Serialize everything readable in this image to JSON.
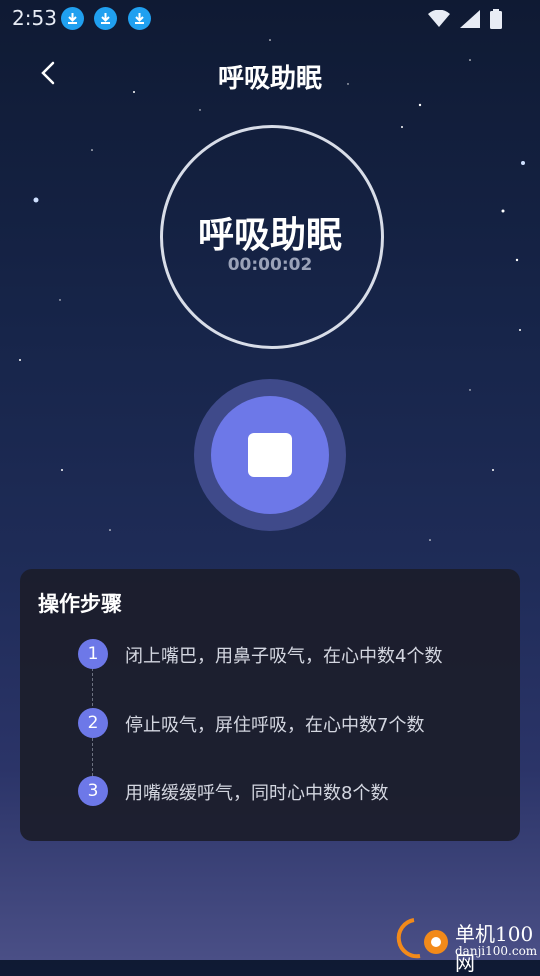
{
  "status": {
    "time": "2:53"
  },
  "header": {
    "title": "呼吸助眠"
  },
  "player": {
    "title": "呼吸助眠",
    "timer": "00:00:02"
  },
  "steps_panel": {
    "title": "操作步骤",
    "steps": [
      {
        "num": "1",
        "text": "闭上嘴巴，用鼻子吸气，在心中数4个数"
      },
      {
        "num": "2",
        "text": "停止吸气，屏住呼吸，在心中数7个数"
      },
      {
        "num": "3",
        "text": "用嘴缓缓呼气，同时心中数8个数"
      }
    ]
  },
  "watermark": {
    "brand": "单机100网",
    "url": "danji100.com"
  },
  "colors": {
    "accent": "#6d78e8",
    "panel": "#1c1e2c",
    "download_badge": "#20a0f0"
  }
}
